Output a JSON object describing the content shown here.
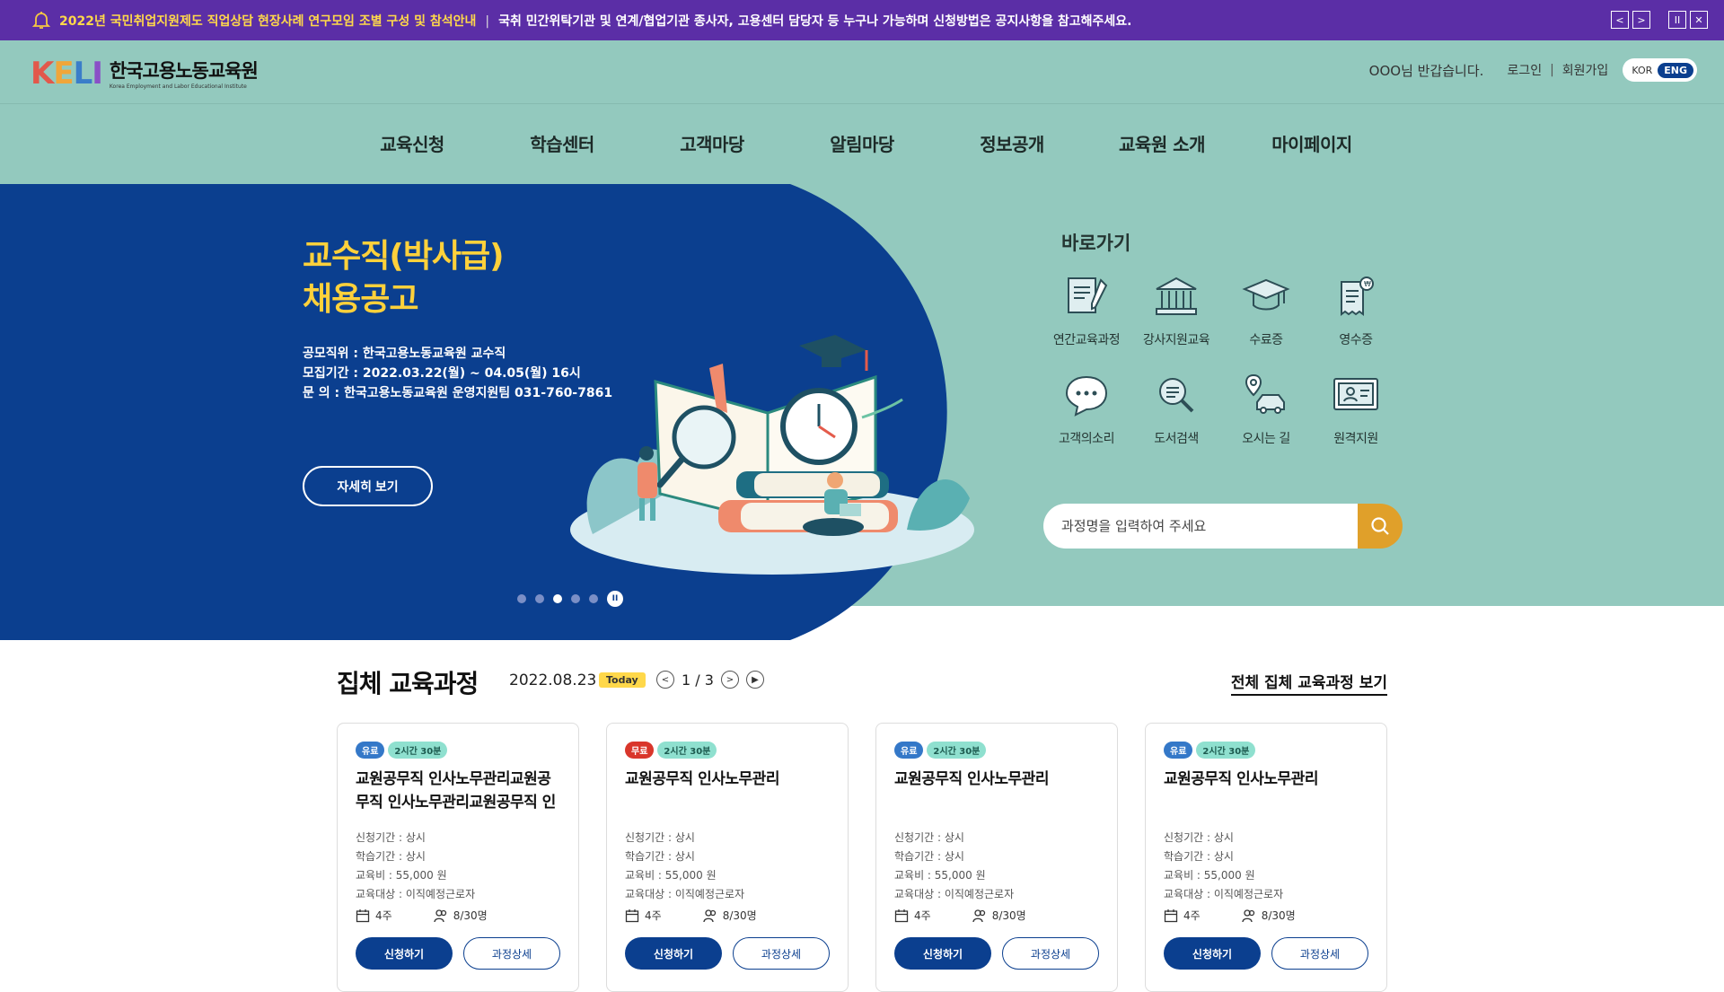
{
  "notice": {
    "headline": "2022년 국민취업지원제도 직업상담 현장사례 연구모임 조별 구성 및 참석안내",
    "detail": "국취 민간위탁기관 및 연계/협업기관 종사자, 고용센터 담당자 등 누구나 가능하며 신청방법은 공지사항을 참고해주세요.",
    "prev_icon": "chevron-left-icon",
    "next_icon": "chevron-right-icon",
    "pause_icon": "pause-icon",
    "close_icon": "close-icon"
  },
  "header": {
    "logo_mark": [
      "K",
      "E",
      "L",
      "I"
    ],
    "logo_name": "한국고용노동교육원",
    "logo_english": "Korea Employment and Labor Educational Institute",
    "greeting": "OOO님 반갑습니다.",
    "login": "로그인",
    "signup": "회원가입",
    "lang_kor": "KOR",
    "lang_eng": "ENG"
  },
  "nav": [
    "교육신청",
    "학습센터",
    "고객마당",
    "알림마당",
    "정보공개",
    "교육원 소개",
    "마이페이지"
  ],
  "hero": {
    "title_line1": "교수직(박사급)",
    "title_line2": "채용공고",
    "info": [
      "공모직위 : 한국고용노동교육원 교수직",
      "모집기간 : 2022.03.22(월) ~ 04.05(월) 16시",
      "문 의 : 한국고용노동교육원 운영지원팀 031-760-7861"
    ],
    "button": "자세히 보기",
    "slide_count": 5,
    "active_slide": 3
  },
  "quick": {
    "title": "바로가기",
    "items": [
      {
        "label": "연간교육과정",
        "icon": "book-pen-icon"
      },
      {
        "label": "강사지원교육",
        "icon": "building-icon"
      },
      {
        "label": "수료증",
        "icon": "graduation-cap-icon"
      },
      {
        "label": "영수증",
        "icon": "receipt-icon"
      },
      {
        "label": "고객의소리",
        "icon": "chat-bubble-icon"
      },
      {
        "label": "도서검색",
        "icon": "magnifier-icon"
      },
      {
        "label": "오시는 길",
        "icon": "car-location-icon"
      },
      {
        "label": "원격지원",
        "icon": "remote-support-icon"
      }
    ],
    "search_placeholder": "과정명을 입력하여 주세요"
  },
  "courses": {
    "title": "집체 교육과정",
    "date": "2022.08.23",
    "today": "Today",
    "page": "1 / 3",
    "view_all": "전체 집체 교육과정 보기",
    "cards": [
      {
        "fee_badge": "유료",
        "fee_type": "paid",
        "time": "2시간 30분",
        "title": "교원공무직 인사노무관리교원공무직 인사노무관리교원공무직 인사노무관리",
        "period": "신청기간 : 상시",
        "study": "학습기간 : 상시",
        "cost": "교육비 : 55,000 원",
        "target": "교육대상 : 이직예정근로자",
        "weeks": "4주",
        "seats": "8/30명",
        "apply": "신청하기",
        "detail": "과정상세"
      },
      {
        "fee_badge": "무료",
        "fee_type": "free",
        "time": "2시간 30분",
        "title": "교원공무직 인사노무관리",
        "period": "신청기간 : 상시",
        "study": "학습기간 : 상시",
        "cost": "교육비 : 55,000 원",
        "target": "교육대상 : 이직예정근로자",
        "weeks": "4주",
        "seats": "8/30명",
        "apply": "신청하기",
        "detail": "과정상세"
      },
      {
        "fee_badge": "유료",
        "fee_type": "paid",
        "time": "2시간 30분",
        "title": "교원공무직 인사노무관리",
        "period": "신청기간 : 상시",
        "study": "학습기간 : 상시",
        "cost": "교육비 : 55,000 원",
        "target": "교육대상 : 이직예정근로자",
        "weeks": "4주",
        "seats": "8/30명",
        "apply": "신청하기",
        "detail": "과정상세"
      },
      {
        "fee_badge": "유료",
        "fee_type": "paid",
        "time": "2시간 30분",
        "title": "교원공무직 인사노무관리",
        "period": "신청기간 : 상시",
        "study": "학습기간 : 상시",
        "cost": "교육비 : 55,000 원",
        "target": "교육대상 : 이직예정근로자",
        "weeks": "4주",
        "seats": "8/30명",
        "apply": "신청하기",
        "detail": "과정상세"
      }
    ]
  },
  "colors": {
    "notice_bg": "#5b2ea6",
    "header_bg": "#93c9be",
    "hero_blue": "#0b3f8f",
    "accent_yellow": "#ffd13b",
    "search_button": "#e0a02a"
  }
}
